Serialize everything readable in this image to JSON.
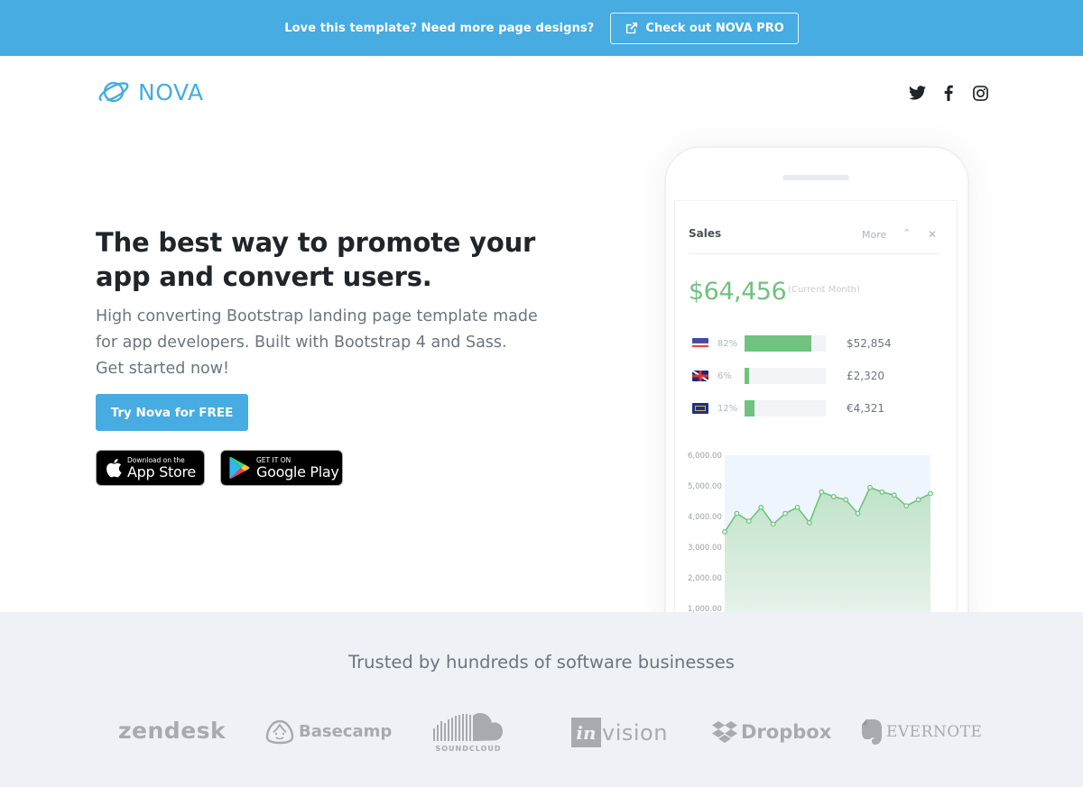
{
  "banner": {
    "text": "Love this template? Need more page designs?",
    "button_label": "Check out NOVA PRO",
    "button_icon": "external-link-icon",
    "background_color": "#46ace1"
  },
  "nav": {
    "logo_text": "NOVA",
    "logo_icon": "planet-icon",
    "brand_color": "#46ace1",
    "social_links": [
      {
        "name": "twitter",
        "icon": "twitter-icon"
      },
      {
        "name": "facebook",
        "icon": "facebook-icon"
      },
      {
        "name": "instagram",
        "icon": "instagram-icon"
      }
    ]
  },
  "hero": {
    "title_line1": "The best way to promote your",
    "title_line2": "app and convert users.",
    "subtitle": "High converting Bootstrap landing page template made for app developers. Built with Bootstrap 4 and Sass. Get started now!",
    "cta_label": "Try Nova for FREE",
    "app_store": {
      "small": "Download on the",
      "big": "App Store",
      "icon": "apple-icon"
    },
    "google_play": {
      "small": "GET IT ON",
      "big": "Google Play",
      "icon": "google-play-icon"
    }
  },
  "phone": {
    "widget_title": "Sales",
    "more_label": "More",
    "collapse_icon": "chevron-up-icon",
    "close_icon": "close-icon",
    "total": "$64,456",
    "total_note": "(Current Month)",
    "countries": [
      {
        "flag": "us-flag-icon",
        "percent_label": "82%",
        "fraction": 0.82,
        "amount": "$52,854"
      },
      {
        "flag": "uk-flag-icon",
        "percent_label": "6%",
        "fraction": 0.06,
        "amount": "£2,320"
      },
      {
        "flag": "eu-flag-icon",
        "percent_label": "12%",
        "fraction": 0.12,
        "amount": "€4,321"
      }
    ],
    "accent_color": "#6fc37f"
  },
  "chart_data": {
    "type": "area",
    "title": "",
    "xlabel": "",
    "ylabel": "",
    "y_ticks": [
      "6,000.00",
      "5,000.00",
      "4,000.00",
      "3,000.00",
      "2,000.00",
      "1,000.00"
    ],
    "y_tick_values": [
      6000,
      5000,
      4000,
      3000,
      2000,
      1000
    ],
    "ylim": [
      1000,
      6000
    ],
    "x": [
      1,
      2,
      3,
      4,
      5,
      6,
      7,
      8,
      9,
      10,
      11,
      12,
      13,
      14,
      15,
      16,
      17,
      18
    ],
    "series": [
      {
        "name": "Sales",
        "values": [
          3500,
          4100,
          3850,
          4300,
          3750,
          4100,
          4300,
          3800,
          4800,
          4650,
          4550,
          4100,
          4950,
          4800,
          4700,
          4350,
          4550,
          4750
        ],
        "color": "#6fc37f"
      }
    ],
    "grid": false,
    "legend": "none"
  },
  "trusted": {
    "title": "Trusted by hundreds of software businesses",
    "logos": [
      {
        "name": "zendesk",
        "label": "zendesk"
      },
      {
        "name": "basecamp",
        "label": "Basecamp"
      },
      {
        "name": "soundcloud",
        "label": "SOUNDCLOUD"
      },
      {
        "name": "invision",
        "label_prefix": "in",
        "label": "vision"
      },
      {
        "name": "dropbox",
        "label": "Dropbox"
      },
      {
        "name": "evernote",
        "label": "EVERNOTE"
      }
    ]
  }
}
